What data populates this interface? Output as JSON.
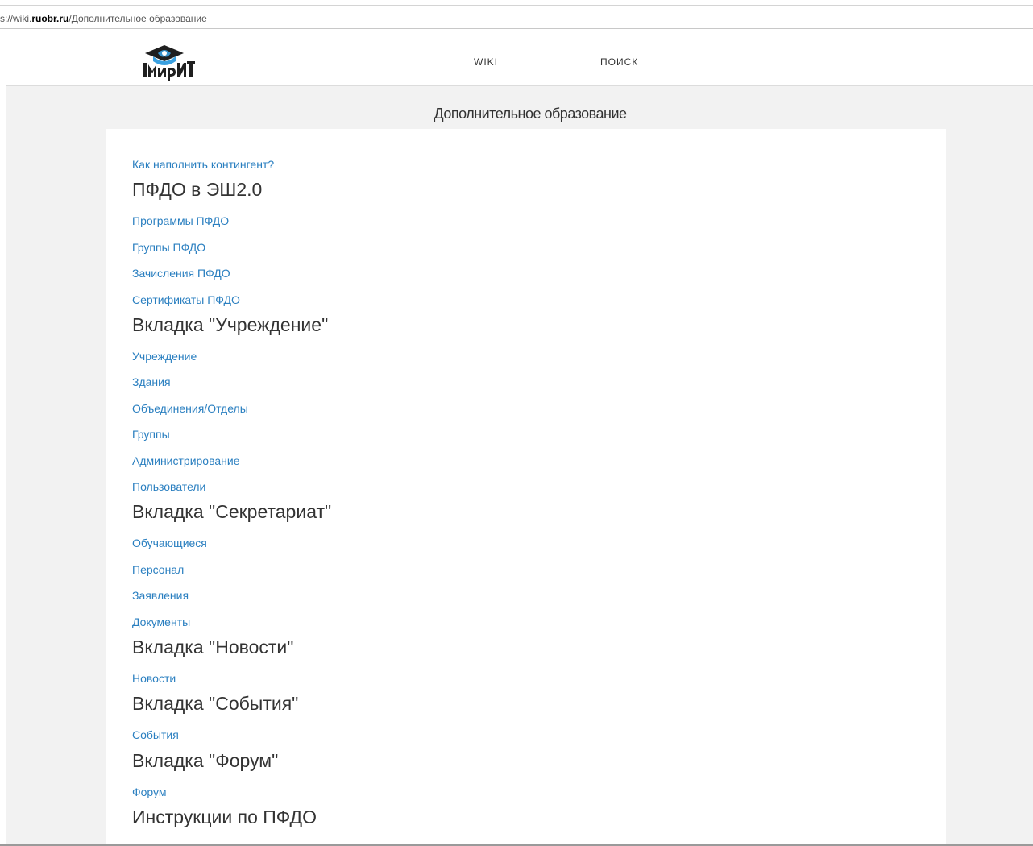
{
  "browser": {
    "url_prefix": "s://wiki.",
    "url_domain": "ruobr.ru",
    "url_path": "/Дополнительное образование"
  },
  "nav": {
    "logo_alt": "ИМиИТ",
    "wiki": "WIKI",
    "search": "ПОИСК"
  },
  "page": {
    "title": "Дополнительное образование"
  },
  "toc": [
    {
      "type": "link",
      "text": "Как наполнить контингент?"
    },
    {
      "type": "heading",
      "text": "ПФДО в ЭШ2.0"
    },
    {
      "type": "link",
      "text": "Программы ПФДО"
    },
    {
      "type": "link",
      "text": "Группы ПФДО"
    },
    {
      "type": "link",
      "text": "Зачисления ПФДО"
    },
    {
      "type": "link",
      "text": "Сертификаты ПФДО"
    },
    {
      "type": "heading",
      "text": "Вкладка \"Учреждение\""
    },
    {
      "type": "link",
      "text": "Учреждение"
    },
    {
      "type": "link",
      "text": "Здания"
    },
    {
      "type": "link",
      "text": "Объединения/Отделы"
    },
    {
      "type": "link",
      "text": "Группы"
    },
    {
      "type": "link",
      "text": "Администрирование"
    },
    {
      "type": "link",
      "text": "Пользователи"
    },
    {
      "type": "heading",
      "text": "Вкладка \"Секретариат\""
    },
    {
      "type": "link",
      "text": "Обучающиеся"
    },
    {
      "type": "link",
      "text": "Персонал"
    },
    {
      "type": "link",
      "text": "Заявления"
    },
    {
      "type": "link",
      "text": "Документы"
    },
    {
      "type": "heading",
      "text": "Вкладка \"Новости\""
    },
    {
      "type": "link",
      "text": "Новости"
    },
    {
      "type": "heading",
      "text": "Вкладка \"События\""
    },
    {
      "type": "link",
      "text": "События"
    },
    {
      "type": "heading",
      "text": "Вкладка \"Форум\""
    },
    {
      "type": "link",
      "text": "Форум"
    },
    {
      "type": "heading",
      "text": "Инструкции по ПФДО"
    }
  ],
  "colors": {
    "link": "#2a7fc0",
    "text": "#333333",
    "page_bg": "#f2f2f2",
    "content_bg": "#ffffff"
  }
}
